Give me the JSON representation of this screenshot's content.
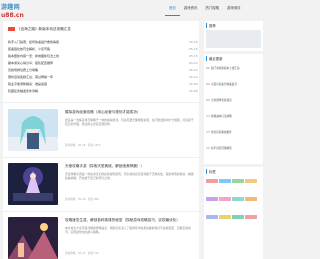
{
  "site": {
    "logo_top": "游趣网",
    "logo_sub": "u88.cn"
  },
  "nav": [
    {
      "label": "首页",
      "active": true
    },
    {
      "label": "游戏资讯",
      "active": false
    },
    {
      "label": "热门攻略",
      "active": false
    },
    {
      "label": "游戏测评",
      "active": false
    }
  ],
  "hot": {
    "title": "《出海之路》新版本玩法攻略汇总"
  },
  "top_list": [
    {
      "title": "新手入门指南：如何快速提升角色等级",
      "date": "05-18"
    },
    {
      "title": "装备强化技巧全解析，少走弯路",
      "date": "05-16"
    },
    {
      "title": "版本更新内容一览：新地图新玩法上线",
      "date": "05-15"
    },
    {
      "title": "副本通关心得分享：组队配置推荐",
      "date": "05-14"
    },
    {
      "title": "竞技场排位赛上分攻略",
      "date": "05-12"
    },
    {
      "title": "限时活动奖励汇总，错过再等一年",
      "date": "05-10"
    },
    {
      "title": "职业平衡调整解读：谁是最强",
      "date": "05-09"
    },
    {
      "title": "隐藏任务触发条件详解",
      "date": "05-08"
    }
  ],
  "cards": [
    {
      "title": "模拟游戏经营攻略（用心经营与规划才能成功）",
      "desc": "经营是一款集养成与策略于一体的模拟游戏，玩家需要合理规划资源，在不断发展中扩大规模，打造属于自己的帝国，通过用心经营实现梦想。",
      "meta": "游戏攻略 · 05-18 · 阅读 1325"
    },
    {
      "title": "天使攻略手游（探索天堂奥秘，解锁绝美神器！）",
      "desc": "天使攻略手游是一款充满奇幻色彩的冒险游戏，玩家将扮演天使穿梭于天堂各处，探索未知的秘境，解锁绝美神器，开启属于自己的传奇之旅。",
      "meta": "游戏攻略 · 05-16 · 阅读 986"
    },
    {
      "title": "攻略速览生涯，解锁各种英雄的秘密（探秘游戏攻略技巧，实现最优化）",
      "desc": "本文将为大家带来详细的攻略速览，帮助玩家深入了解游戏中各类英雄的特点与技能搭配，掌握实用技巧，实现最优化的战斗策略。",
      "meta": "游戏攻略 · 05-15 · 阅读 742"
    }
  ],
  "sidebar": {
    "box1_title": "推荐",
    "box2_title": "最近更新",
    "recent": [
      {
        "num": "01",
        "hot": true,
        "title": "热门游戏新版本上线汇总"
      },
      {
        "num": "02",
        "hot": true,
        "title": "平民玩家如何快速发育"
      },
      {
        "num": "03",
        "hot": true,
        "title": "全新赛季奖励预览"
      },
      {
        "num": "04",
        "hot": false,
        "title": "经典副本打法攻略"
      },
      {
        "num": "05",
        "hot": false,
        "title": "角色培养路线推荐"
      },
      {
        "num": "06",
        "hot": false,
        "title": "新手常见问题解答"
      }
    ],
    "box3_title": "标签",
    "swatch_colors": [
      "#f39c9c",
      "#7fc8f8",
      "#9bd3a1",
      "#f7c97f",
      "#c9a3e6",
      "#f5a3c7",
      "#8ed8d0",
      "#f2b880",
      "#a5b9f0",
      "#e8d36f",
      "#7fd1b9",
      "#f0a0a0"
    ]
  }
}
